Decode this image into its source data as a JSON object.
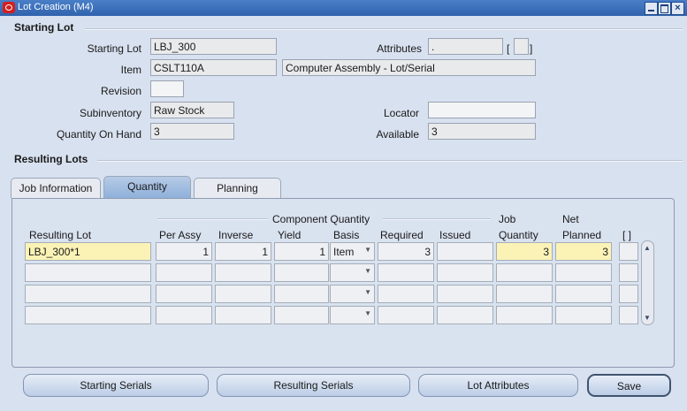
{
  "window": {
    "title": "Lot Creation (M4)",
    "close_glyph": "×"
  },
  "starting_lot_section": {
    "title": "Starting Lot",
    "starting_lot": {
      "label": "Starting Lot",
      "value": "LBJ_300"
    },
    "attributes": {
      "label": "Attributes",
      "value": ".",
      "bracket_open": "[",
      "bracket_close": "]"
    },
    "item": {
      "label": "Item",
      "value": "CSLT110A",
      "description": "Computer Assembly - Lot/Serial"
    },
    "revision": {
      "label": "Revision",
      "value": ""
    },
    "subinventory": {
      "label": "Subinventory",
      "value": "Raw Stock"
    },
    "locator": {
      "label": "Locator",
      "value": ""
    },
    "quantity_on_hand": {
      "label": "Quantity On Hand",
      "value": "3"
    },
    "available": {
      "label": "Available",
      "value": "3"
    }
  },
  "resulting_lots_section": {
    "title": "Resulting Lots",
    "tabs": [
      {
        "label": "Job Information",
        "active": false
      },
      {
        "label": "Quantity",
        "active": true
      },
      {
        "label": "Planning",
        "active": false
      }
    ],
    "group_header": "Component Quantity",
    "columns": {
      "resulting_lot": "Resulting Lot",
      "per_assy": "Per Assy",
      "inverse": "Inverse",
      "yield": "Yield",
      "basis": "Basis",
      "required": "Required",
      "issued": "Issued",
      "job_quantity_1": "Job",
      "job_quantity_2": "Quantity",
      "net_planned_1": "Net",
      "net_planned_2": "Planned",
      "flex": "[ ]"
    },
    "rows": [
      {
        "resulting_lot": "LBJ_300*1",
        "per_assy": "1",
        "inverse": "1",
        "yield": "1",
        "basis": "Item",
        "required": "3",
        "issued": "",
        "job_quantity": "3",
        "net_planned": "3"
      },
      {
        "resulting_lot": "",
        "per_assy": "",
        "inverse": "",
        "yield": "",
        "basis": "",
        "required": "",
        "issued": "",
        "job_quantity": "",
        "net_planned": ""
      },
      {
        "resulting_lot": "",
        "per_assy": "",
        "inverse": "",
        "yield": "",
        "basis": "",
        "required": "",
        "issued": "",
        "job_quantity": "",
        "net_planned": ""
      },
      {
        "resulting_lot": "",
        "per_assy": "",
        "inverse": "",
        "yield": "",
        "basis": "",
        "required": "",
        "issued": "",
        "job_quantity": "",
        "net_planned": ""
      }
    ]
  },
  "buttons": {
    "starting_serials": "Starting Serials",
    "resulting_serials": "Resulting Serials",
    "lot_attributes": "Lot Attributes",
    "save": "Save"
  },
  "colors": {
    "titlebar": "#2f63ad",
    "background": "#d8e1ef",
    "highlight_field": "#fbf3b6",
    "close_icon": "#d21f1f"
  }
}
